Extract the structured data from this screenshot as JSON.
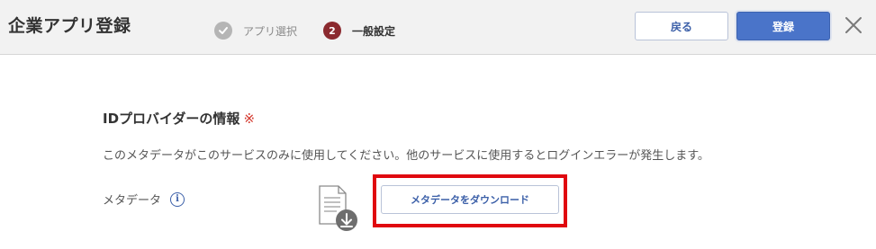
{
  "header": {
    "title": "企業アプリ登録",
    "steps": [
      {
        "number": "",
        "label": "アプリ選択",
        "state": "completed"
      },
      {
        "number": "2",
        "label": "一般設定",
        "state": "current"
      }
    ],
    "back_label": "戻る",
    "register_label": "登録",
    "close_icon": "close-icon"
  },
  "main": {
    "section_title": "IDプロバイダーの情報",
    "required_mark": "※",
    "notice": "このメタデータがこのサービスのみに使用してください。他のサービスに使用するとログインエラーが発生します。",
    "metadata_label": "メタデータ",
    "info_icon_glyph": "i",
    "download_label": "メタデータをダウンロード"
  },
  "colors": {
    "accent": "#4a74c9",
    "step_current": "#8b2a2f",
    "step_done": "#b5b5b5",
    "required": "#d43a2f",
    "highlight": "#e0080f"
  }
}
